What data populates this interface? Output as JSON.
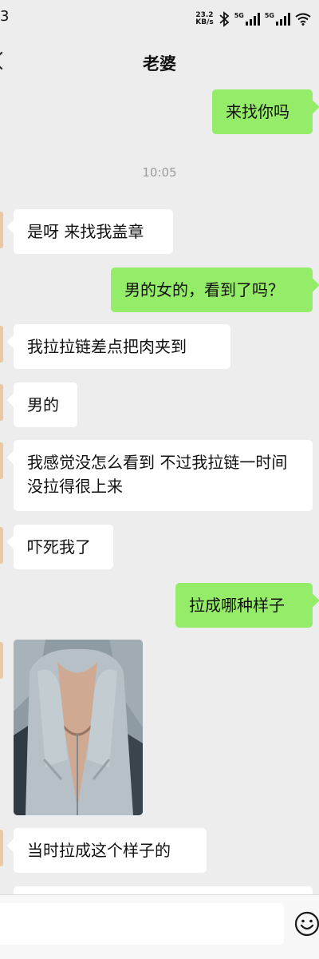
{
  "status_bar": {
    "left_text": "3",
    "net_speed_value": "23.2",
    "net_speed_unit": "KB/s",
    "sim1_label": "5G",
    "sim2_label": "5G"
  },
  "header": {
    "title": "老婆"
  },
  "chat": {
    "timestamp": "10:05",
    "messages": [
      {
        "side": "out",
        "text": "来找你吗"
      },
      {
        "side": "in",
        "text": "是呀 来找我盖章"
      },
      {
        "side": "out",
        "text": "男的女的，看到了吗？"
      },
      {
        "side": "in",
        "text": "我拉拉链差点把肉夹到"
      },
      {
        "side": "in",
        "text": "男的"
      },
      {
        "side": "in",
        "text": "我感觉没怎么看到 不过我拉链一时间没拉得很上来"
      },
      {
        "side": "in",
        "text": "吓死我了"
      },
      {
        "side": "out",
        "text": "拉成哪种样子"
      },
      {
        "side": "in",
        "type": "image"
      },
      {
        "side": "in",
        "text": "当时拉成这个样子的"
      }
    ]
  },
  "input_bar": {
    "value": "",
    "emoji_icon": "smiley-face-icon"
  },
  "colors": {
    "background": "#ededed",
    "outgoing_bubble": "#95ec69",
    "incoming_bubble": "#ffffff"
  }
}
